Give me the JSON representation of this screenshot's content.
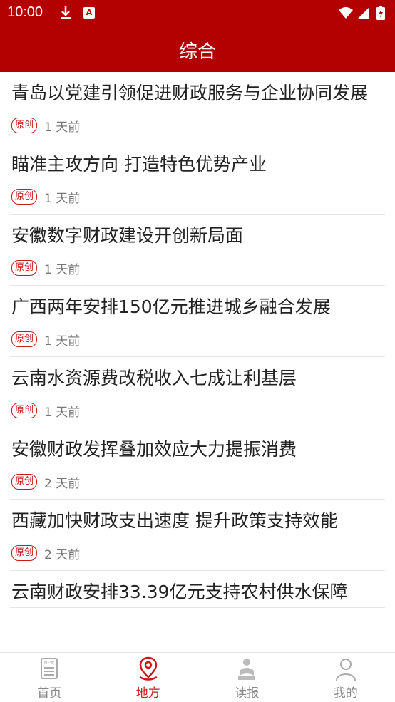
{
  "status_bar": {
    "time": "10:00"
  },
  "header": {
    "title": "综合"
  },
  "articles": [
    {
      "title": " 青岛以党建引领促进财政服务与企业协同发展",
      "tag": "原创",
      "time": "1 天前"
    },
    {
      "title": "瞄准主攻方向 打造特色优势产业",
      "tag": "原创",
      "time": "1 天前"
    },
    {
      "title": "安徽数字财政建设开创新局面",
      "tag": "原创",
      "time": "1 天前"
    },
    {
      "title": "广西两年安排150亿元推进城乡融合发展",
      "tag": "原创",
      "time": "1 天前"
    },
    {
      "title": "云南水资源费改税收入七成让利基层",
      "tag": "原创",
      "time": "1 天前"
    },
    {
      "title": "安徽财政发挥叠加效应大力提振消费",
      "tag": "原创",
      "time": "2 天前"
    },
    {
      "title": "西藏加快财政支出速度 提升政策支持效能",
      "tag": "原创",
      "time": "2 天前"
    },
    {
      "title": "云南财政安排33.39亿元支持农村供水保障",
      "tag": "",
      "time": ""
    }
  ],
  "tabbar": {
    "items": [
      {
        "label": "首页",
        "icon": "news-icon",
        "active": false
      },
      {
        "label": "地方",
        "icon": "location-pin-icon",
        "active": true
      },
      {
        "label": "读报",
        "icon": "reader-icon",
        "active": false
      },
      {
        "label": "我的",
        "icon": "user-icon",
        "active": false
      }
    ]
  },
  "colors": {
    "brand": "#b30000",
    "accent": "#c81a1a"
  }
}
